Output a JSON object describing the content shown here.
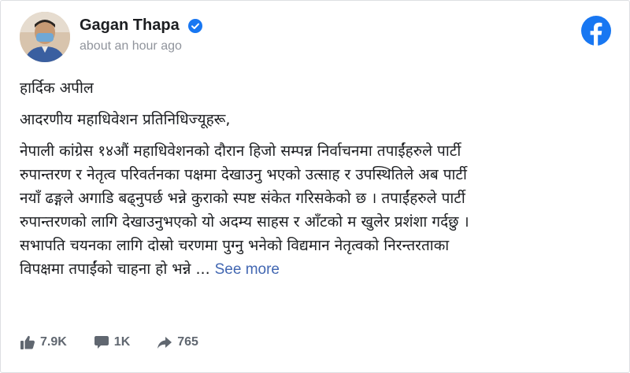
{
  "post": {
    "author_name": "Gagan Thapa",
    "timestamp": "about an hour ago",
    "paragraphs": [
      "हार्दिक अपील",
      "आदरणीय महाधिवेशन प्रतिनिधिज्यूहरू,"
    ],
    "main_lines": [
      "नेपाली कांग्रेस १४औं महाधिवेशनको दौरान हिजो सम्पन्न निर्वाचनमा तपाईंहरुले पार्टी",
      "रुपान्तरण र नेतृत्व परिवर्तनका पक्षमा देखाउनु भएको उत्साह र उपस्थितिले अब पार्टी",
      "नयाँ ढङ्गले अगाडि बढ्नुपर्छ भन्ने कुराको स्पष्ट संकेत गरिसकेको छ । तपाईंहरुले पार्टी",
      "रुपान्तरणको लागि देखाउनुभएको यो अदम्य साहस र आँटको म खुलेर प्रशंशा गर्दछु ।",
      "सभापति चयनका लागि दोस्रो चरणमा पुग्नु भनेको विद्यमान नेतृत्वको निरन्तरताका",
      "विपक्षमा तपाईंको चाहना हो भन्ने ..."
    ],
    "see_more_label": "See more"
  },
  "footer": {
    "likes": "7.9K",
    "comments": "1K",
    "shares": "765"
  },
  "colors": {
    "facebook_blue": "#1877f2",
    "link_blue": "#4267b2",
    "muted": "#90949c"
  },
  "icons": [
    "verified-badge-icon",
    "facebook-logo-icon",
    "like-icon",
    "comment-icon",
    "share-icon"
  ]
}
